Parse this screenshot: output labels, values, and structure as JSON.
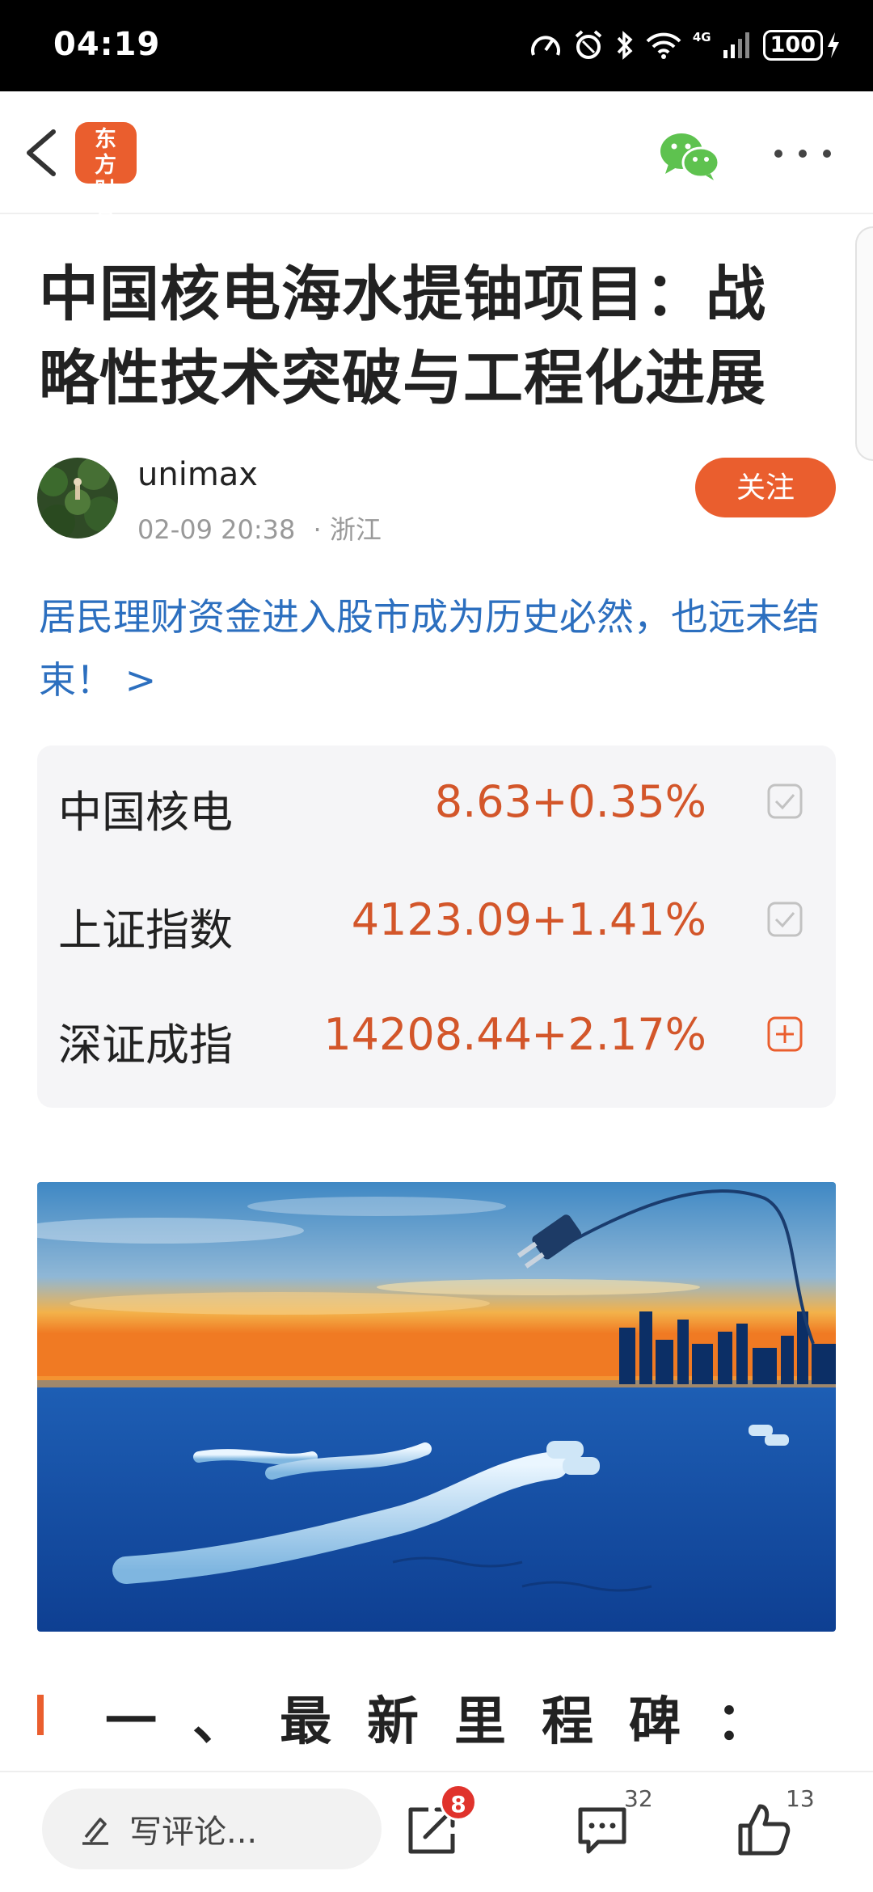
{
  "status_bar": {
    "time": "04:19",
    "network": "4G",
    "battery": "100",
    "icons": [
      "speedometer-icon",
      "alarm-icon",
      "bluetooth-icon",
      "wifi-icon",
      "signal-icon",
      "battery-icon",
      "charging-icon"
    ]
  },
  "header": {
    "logo_text": "东方财富",
    "back_icon": "back-chevron-icon",
    "share_icon": "wechat-icon",
    "more_icon": "more-icon"
  },
  "article": {
    "title": "中国核电海水提铀项目：战略性技术突破与工程化进展",
    "author": {
      "name": "unimax",
      "date": "02-09 20:38",
      "location": "· 浙江",
      "follow_label": "关注"
    },
    "promo_link": "居民理财资金进入股市成为历史必然，也远未结束！ >",
    "section_heading": "一、最新里程碑："
  },
  "stocks": [
    {
      "name": "中国核电",
      "price": "8.63",
      "change": "+0.35%",
      "action": "checked-icon"
    },
    {
      "name": "上证指数",
      "price": "4123.09",
      "change": "+1.41%",
      "action": "checked-icon"
    },
    {
      "name": "深证成指",
      "price": "14208.44",
      "change": "+2.17%",
      "action": "add-icon"
    }
  ],
  "bottom_bar": {
    "comment_placeholder": "写评论...",
    "share_badge": "8",
    "comment_count": "32",
    "like_count": "13"
  },
  "colors": {
    "accent": "#ea5e2e",
    "stock_up": "#d3562a",
    "link": "#2c6fbf",
    "badge": "#e0332c"
  }
}
